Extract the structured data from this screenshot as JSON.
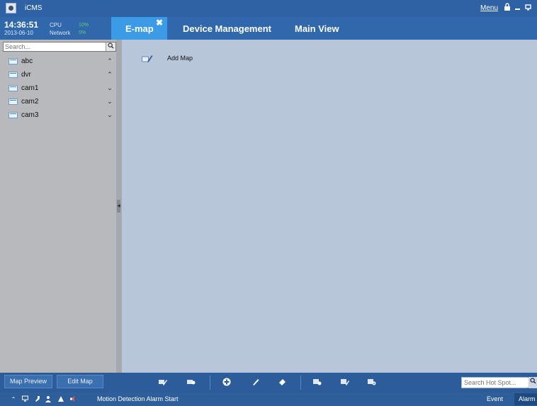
{
  "window": {
    "app_name": "iCMS",
    "menu_label": "Menu",
    "controls": [
      "lock-icon",
      "minimize-icon",
      "restore-icon"
    ]
  },
  "header": {
    "time": "14:36:51",
    "date": "2013-06-10",
    "cpu_label": "CPU",
    "cpu_value": "10%",
    "network_label": "Network",
    "network_value": "0%",
    "tabs": [
      {
        "label": "E-map",
        "active": true
      },
      {
        "label": "Device Management",
        "active": false
      },
      {
        "label": "Main View",
        "active": false
      }
    ]
  },
  "sidebar": {
    "search_placeholder": "Search...",
    "items": [
      {
        "label": "abc",
        "expanded": true
      },
      {
        "label": "dvr",
        "expanded": true
      },
      {
        "label": "cam1",
        "expanded": false
      },
      {
        "label": "cam2",
        "expanded": false
      },
      {
        "label": "cam3",
        "expanded": false
      }
    ]
  },
  "main": {
    "add_map_label": "Add Map"
  },
  "toolbar": {
    "map_preview_label": "Map Preview",
    "edit_map_label": "Edit Map",
    "hot_spot_placeholder": "Search Hot Spot..."
  },
  "statusbar": {
    "message": "Motion Detection Alarm Start",
    "event_label": "Event",
    "alarm_label": "Alarm"
  },
  "colors": {
    "titlebar": "#2e62a4",
    "active_tab": "#3c9be6",
    "sidebar_bg": "#b7b9bc",
    "main_bg": "#b8c6d9",
    "cpu_green": "#5fd06a"
  }
}
